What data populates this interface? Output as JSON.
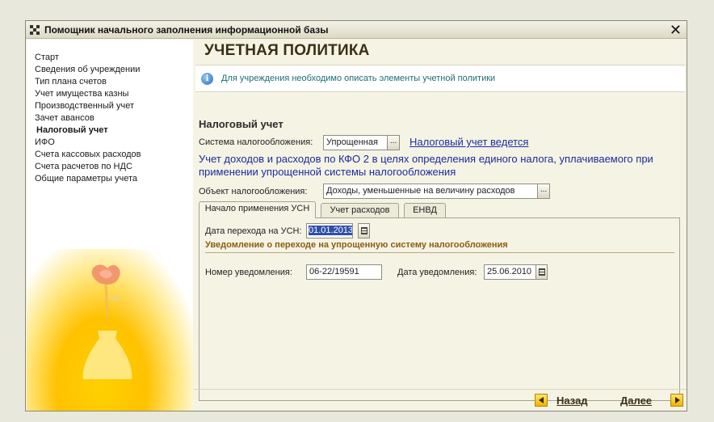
{
  "window": {
    "title": "Помощник начального заполнения информационной базы"
  },
  "sidebar": {
    "items": [
      {
        "label": "Старт",
        "active": false
      },
      {
        "label": "Сведения об учреждении",
        "active": false
      },
      {
        "label": "Тип плана счетов",
        "active": false
      },
      {
        "label": "Учет имущества казны",
        "active": false
      },
      {
        "label": "Производственный учет",
        "active": false
      },
      {
        "label": "Зачет авансов",
        "active": false
      },
      {
        "label": "Налоговый учет",
        "active": true
      },
      {
        "label": "ИФО",
        "active": false
      },
      {
        "label": "Счета кассовых расходов",
        "active": false
      },
      {
        "label": "Счета расчетов по НДС",
        "active": false
      },
      {
        "label": "Общие параметры учета",
        "active": false
      }
    ]
  },
  "main": {
    "page_title": "УЧЕТНАЯ ПОЛИТИКА",
    "info_text": "Для учреждения необходимо описать элементы учетной политики",
    "section_title": "Налоговый учет",
    "tax_system": {
      "label": "Система налогообложения:",
      "value": "Упрощенная",
      "button": "..."
    },
    "tax_link": "Налоговый учет ведется",
    "usn_description": "Учет доходов и расходов по КФО 2 в целях определения единого налога, уплачиваемого при применении упрощенной системы налогообложения",
    "tax_object": {
      "label": "Объект налогообложения:",
      "value": "Доходы, уменьшенные на величину расходов",
      "button": "..."
    },
    "tabs": [
      {
        "label": "Начало применения УСН",
        "active": true
      },
      {
        "label": "Учет расходов",
        "active": false
      },
      {
        "label": "ЕНВД",
        "active": false
      }
    ],
    "usn_tab": {
      "transition_date_label": "Дата перехода на УСН:",
      "transition_date": "01.01.2013",
      "notice_title": "Уведомление о переходе на упрощенную систему налогообложения",
      "notice_number_label": "Номер уведомления:",
      "notice_number": "06-22/19591",
      "notice_date_label": "Дата уведомления:",
      "notice_date": "25.06.2010"
    }
  },
  "footer": {
    "back_label": "Назад",
    "next_label": "Далее"
  },
  "colors": {
    "accent": "#ffc200",
    "link": "#1b2fa3",
    "info_text": "#1c6d74",
    "section_heading": "#8c5d12"
  },
  "icons": {
    "app": "checkered-flag-icon",
    "close": "close-icon",
    "info": "info-icon",
    "calendar": "calendar-icon",
    "back": "arrow-left-icon",
    "next": "arrow-right-icon"
  }
}
